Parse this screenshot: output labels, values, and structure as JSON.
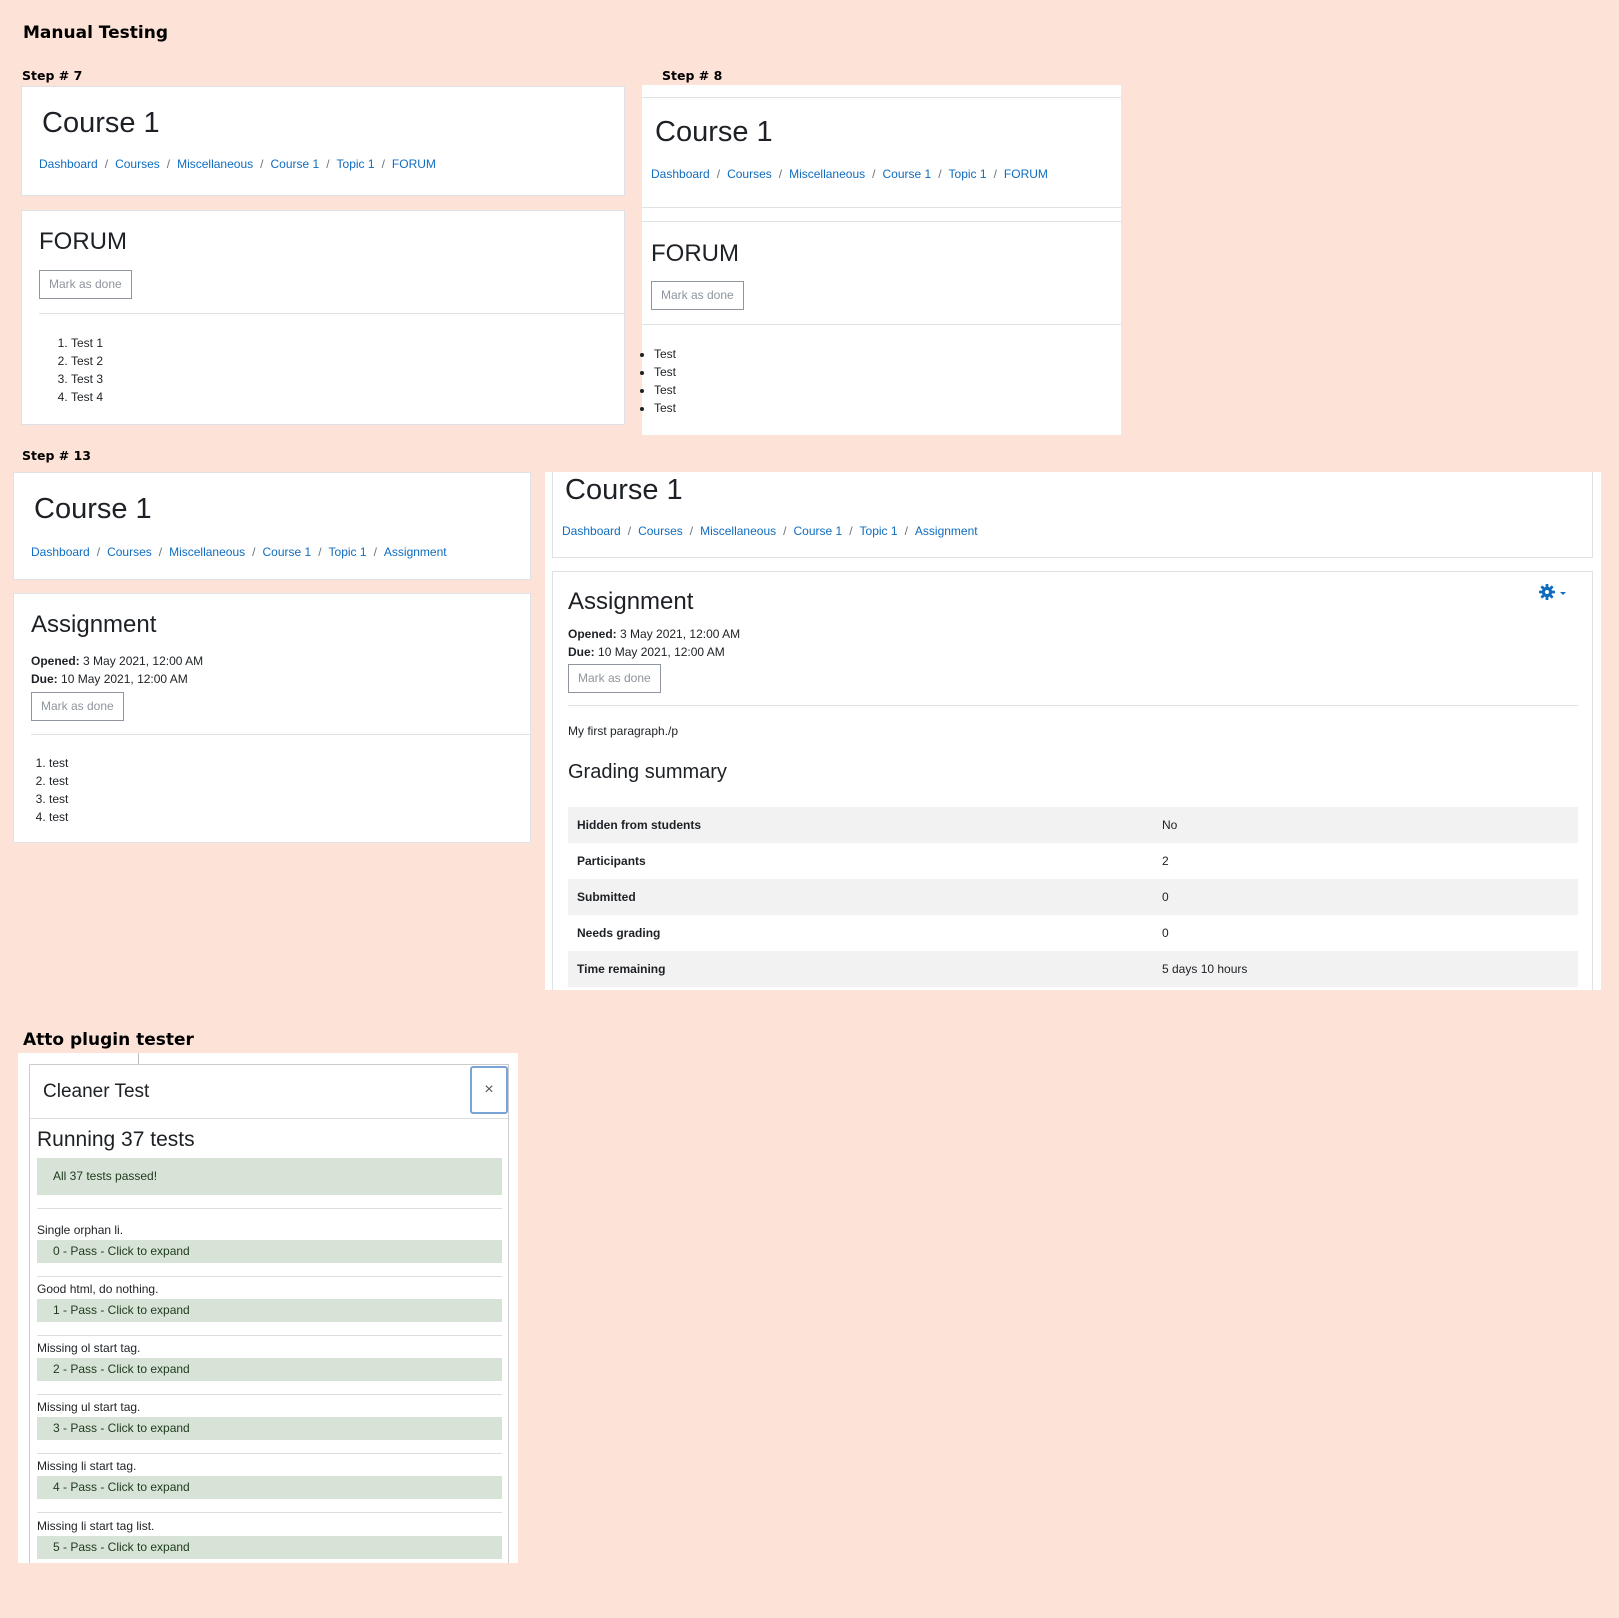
{
  "headings": {
    "manual": "Manual Testing",
    "step7": "Step # 7",
    "step8": "Step # 8",
    "step13": "Step # 13",
    "atto": "Atto plugin tester"
  },
  "forum7": {
    "course_title": "Course 1",
    "breadcrumb": [
      "Dashboard",
      "Courses",
      "Miscellaneous",
      "Course 1",
      "Topic 1",
      "FORUM"
    ],
    "module_title": "FORUM",
    "mark_done": "Mark as done",
    "items": [
      "Test 1",
      "Test 2",
      "Test 3",
      "Test 4"
    ]
  },
  "forum8": {
    "course_title": "Course 1",
    "breadcrumb": [
      "Dashboard",
      "Courses",
      "Miscellaneous",
      "Course 1",
      "Topic 1",
      "FORUM"
    ],
    "module_title": "FORUM",
    "mark_done": "Mark as done",
    "items": [
      "Test",
      "Test",
      "Test",
      "Test"
    ]
  },
  "assign13": {
    "course_title": "Course 1",
    "breadcrumb": [
      "Dashboard",
      "Courses",
      "Miscellaneous",
      "Course 1",
      "Topic 1",
      "Assignment"
    ],
    "module_title": "Assignment",
    "opened_label": "Opened:",
    "opened_value": "3 May 2021, 12:00 AM",
    "due_label": "Due:",
    "due_value": "10 May 2021, 12:00 AM",
    "mark_done": "Mark as done",
    "items": [
      "test",
      "test",
      "test",
      "test"
    ]
  },
  "assignRight": {
    "course_title": "Course 1",
    "breadcrumb": [
      "Dashboard",
      "Courses",
      "Miscellaneous",
      "Course 1",
      "Topic 1",
      "Assignment"
    ],
    "module_title": "Assignment",
    "opened_label": "Opened:",
    "opened_value": "3 May 2021, 12:00 AM",
    "due_label": "Due:",
    "due_value": "10 May 2021, 12:00 AM",
    "mark_done": "Mark as done",
    "paragraph": "My first paragraph./p",
    "grading_title": "Grading summary",
    "grading_rows": [
      {
        "k": "Hidden from students",
        "v": "No"
      },
      {
        "k": "Participants",
        "v": "2"
      },
      {
        "k": "Submitted",
        "v": "0"
      },
      {
        "k": "Needs grading",
        "v": "0"
      },
      {
        "k": "Time remaining",
        "v": "5 days 10 hours"
      }
    ],
    "gear_icon": "gear-icon",
    "accent": "#0f6cbf"
  },
  "atto": {
    "dialog_title": "Cleaner Test",
    "close_label": "×",
    "running": "Running 37 tests",
    "summary": "All 37 tests passed!",
    "tests": [
      {
        "name": "Single orphan li.",
        "result": "0 - Pass - Click to expand"
      },
      {
        "name": "Good html, do nothing.",
        "result": "1 - Pass - Click to expand"
      },
      {
        "name": "Missing ol start tag.",
        "result": "2 - Pass - Click to expand"
      },
      {
        "name": "Missing ul start tag.",
        "result": "3 - Pass - Click to expand"
      },
      {
        "name": "Missing li start tag.",
        "result": "4 - Pass - Click to expand"
      },
      {
        "name": "Missing li start tag list.",
        "result": "5 - Pass - Click to expand"
      }
    ],
    "pass_color": "#d7e3d7"
  }
}
